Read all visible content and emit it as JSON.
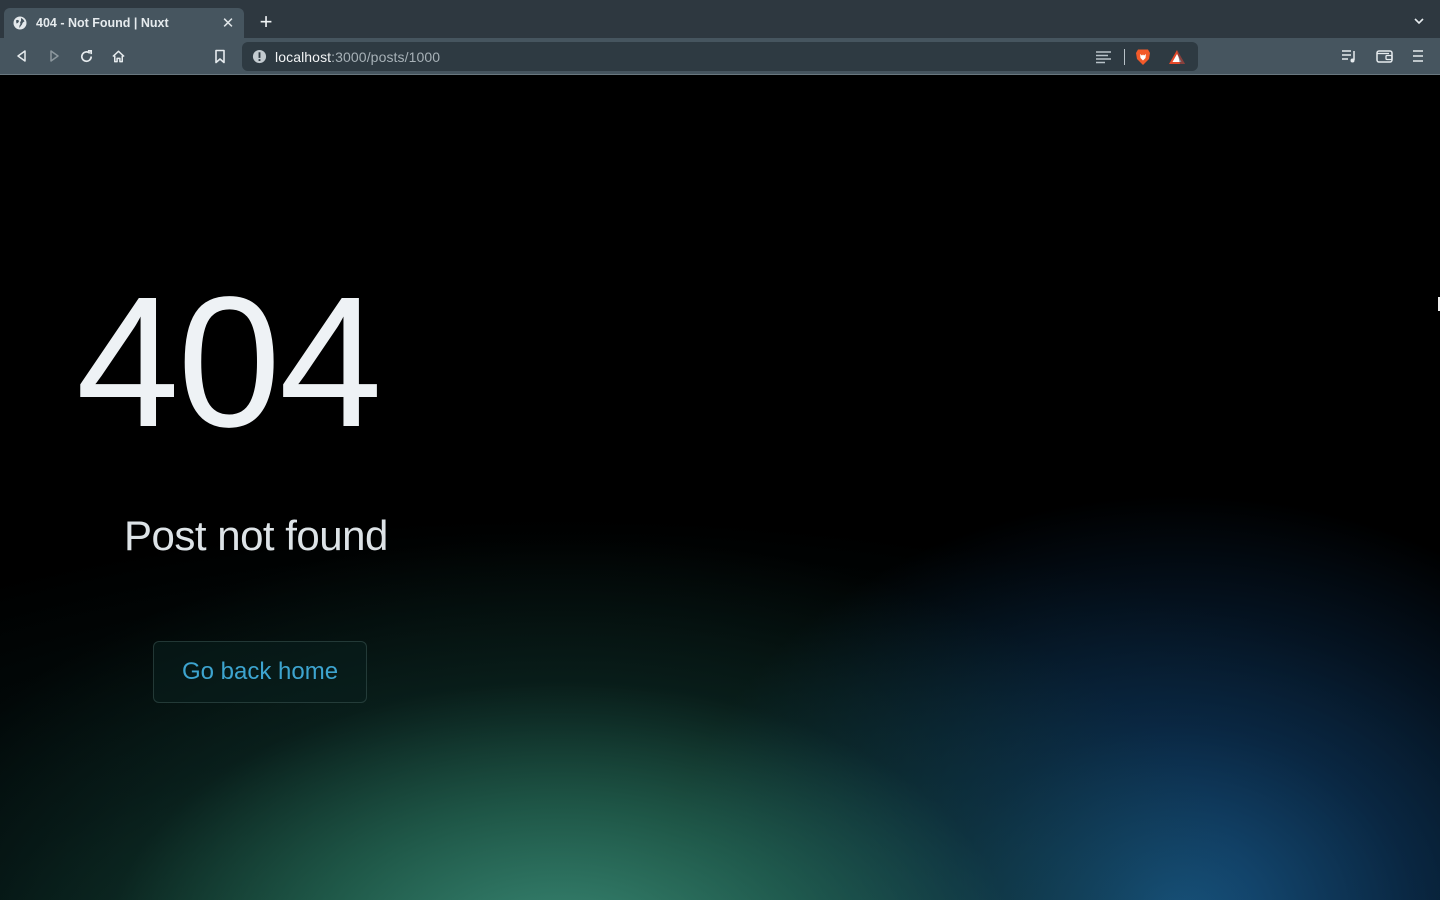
{
  "browser": {
    "tab": {
      "title": "404 - Not Found | Nuxt",
      "icon": "globe-icon"
    },
    "new_tab_label": "+",
    "close_label": "✕",
    "url": {
      "host": "localhost",
      "path": ":3000/posts/1000"
    },
    "toolbar_icons": [
      "back-icon",
      "forward-icon",
      "reload-icon",
      "home-icon",
      "bookmark-icon",
      "info-icon",
      "reader-mode-icon",
      "brave-shields-icon",
      "brave-rewards-icon",
      "media-playlist-icon",
      "wallet-icon",
      "menu-icon"
    ],
    "colors": {
      "tabstrip": "#2e3840",
      "toolbar": "#46555f",
      "urlbar": "#2e3a42",
      "shields": "#f25a2a"
    }
  },
  "page": {
    "error_code": "404",
    "message": "Post not found",
    "home_button_label": "Go back home",
    "colors": {
      "background": "#000000",
      "text": "#eef2f5",
      "link": "#3da4cf",
      "glow_green": "#3c8c78",
      "glow_blue": "#195a8c"
    }
  }
}
